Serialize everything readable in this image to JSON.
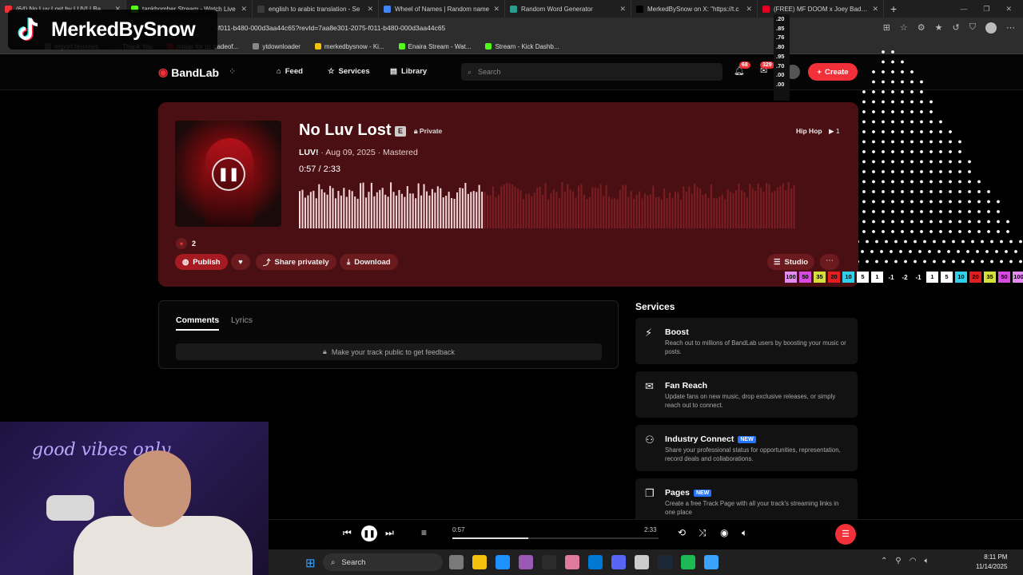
{
  "browser": {
    "tabs": [
      {
        "label": "(64) No Luv Lost by LUV! | Ba",
        "color": "#f2303a",
        "active": true
      },
      {
        "label": "tankbomber Stream - Watch Live",
        "color": "#53fc18"
      },
      {
        "label": "english to arabic translation - Se",
        "color": "#3b3b3b"
      },
      {
        "label": "Wheel of Names | Random name",
        "color": "#4285f4"
      },
      {
        "label": "Random Word Generator",
        "color": "#2a9d8f"
      },
      {
        "label": "MerkedBySnow on X: \"https://t.c",
        "color": "#000000"
      },
      {
        "label": "(FREE) MF DOOM x Joey Bada$$",
        "color": "#e60023"
      }
    ],
    "url": "-f011-b480-000d3aa44c65?revId=7aa8e301-2075-f011-b480-000d3aa44c65",
    "bookmarks": [
      {
        "label": "Import favorites",
        "color": "#777777"
      },
      {
        "label": "Thank You",
        "color": "#333333"
      },
      {
        "label": "midas for uc tradeof...",
        "color": "#cc2222"
      },
      {
        "label": "ytdownloader",
        "color": "#888888"
      },
      {
        "label": "merkedbysnow - Ki...",
        "color": "#f4c20d"
      },
      {
        "label": "Enaira Stream - Wat...",
        "color": "#53fc18"
      },
      {
        "label": "Stream - Kick Dashb...",
        "color": "#53fc18"
      }
    ]
  },
  "overlay": {
    "channel_name": "MerkedBySnow"
  },
  "nav": {
    "logo": "BandLab",
    "feed": "Feed",
    "services": "Services",
    "library": "Library",
    "search_placeholder": "Search",
    "notifications_count": "68",
    "messages_count": "329",
    "create": "Create"
  },
  "track": {
    "title": "No Luv Lost",
    "explicit": "E",
    "visibility": "Private",
    "artist": "LUV!",
    "meta_rest": " · Aug 09, 2025 · Mastered",
    "current_time": "0:57",
    "separator": " / ",
    "duration": "2:33",
    "genre": "Hip Hop",
    "plays": "1",
    "likes": "2",
    "progress": 0.37,
    "actions": {
      "publish": "Publish",
      "share": "Share privately",
      "download": "Download",
      "studio": "Studio"
    }
  },
  "comments": {
    "tab_comments": "Comments",
    "tab_lyrics": "Lyrics",
    "notice": "Make your track public to get feedback"
  },
  "services": {
    "title": "Services",
    "items": [
      {
        "name": "Boost",
        "is_new": false,
        "desc": "Reach out to millions of BandLab users by boosting your music or posts.",
        "icon": "lightning-icon"
      },
      {
        "name": "Fan Reach",
        "is_new": false,
        "desc": "Update fans on new music, drop exclusive releases, or simply reach out to connect.",
        "icon": "mail-icon"
      },
      {
        "name": "Industry Connect",
        "is_new": true,
        "desc": "Share your professional status for opportunities, representation, record deals and collaborations.",
        "icon": "people-icon"
      },
      {
        "name": "Pages",
        "is_new": true,
        "desc": "Create a free Track Page with all your track's streaming links in one place",
        "icon": "pages-icon"
      }
    ],
    "new_label": "NEW"
  },
  "player": {
    "current": "0:57",
    "total": "2:33",
    "progress": 0.37
  },
  "ruler": [
    ".20",
    ".85",
    ".76",
    ".80",
    ".95",
    ".70",
    ".00",
    ".00"
  ],
  "meter": {
    "left": [
      {
        "v": "100",
        "c": "#e58cf0"
      },
      {
        "v": "50",
        "c": "#d84be0"
      },
      {
        "v": "35",
        "c": "#d6e03a"
      },
      {
        "v": "20",
        "c": "#e02020"
      },
      {
        "v": "10",
        "c": "#2fd0e8"
      },
      {
        "v": "5",
        "c": "#ffffff"
      },
      {
        "v": "1",
        "c": "#ffffff"
      }
    ],
    "mid": [
      "-1",
      "-2",
      "-1"
    ],
    "right": [
      {
        "v": "1",
        "c": "#ffffff"
      },
      {
        "v": "5",
        "c": "#ffffff"
      },
      {
        "v": "10",
        "c": "#2fd0e8"
      },
      {
        "v": "20",
        "c": "#e02020"
      },
      {
        "v": "35",
        "c": "#d6e03a"
      },
      {
        "v": "50",
        "c": "#d84be0"
      },
      {
        "v": "100",
        "c": "#e58cf0"
      }
    ]
  },
  "webcam": {
    "neon_text": "good vibes only"
  },
  "taskbar": {
    "search": "Search",
    "time": "8:11 PM",
    "date": "11/14/2025"
  },
  "colors": {
    "accent": "#f2303a",
    "card": "#4a0f12"
  }
}
